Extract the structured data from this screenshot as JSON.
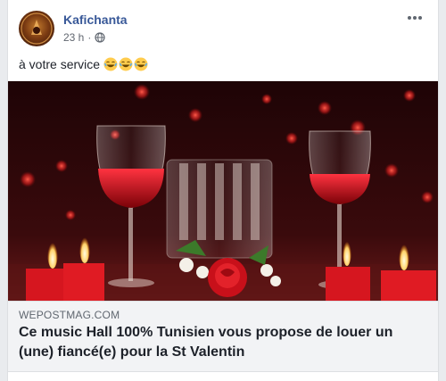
{
  "post": {
    "author": "Kafichanta",
    "time": "23 h",
    "privacy_icon": "globe-icon",
    "more_icon": "more-options-icon",
    "caption": "à votre service",
    "emojis": [
      "laughing-face-icon",
      "laughing-face-icon",
      "laughing-face-icon"
    ]
  },
  "link": {
    "domain": "WEPOSTMAG.COM",
    "title": "Ce music Hall 100% Tunisien vous propose de louer un (une) fiancé(e) pour la St Valentin"
  },
  "colors": {
    "author": "#385898",
    "background": "#e9ebee",
    "link_box": "#f2f3f5"
  }
}
